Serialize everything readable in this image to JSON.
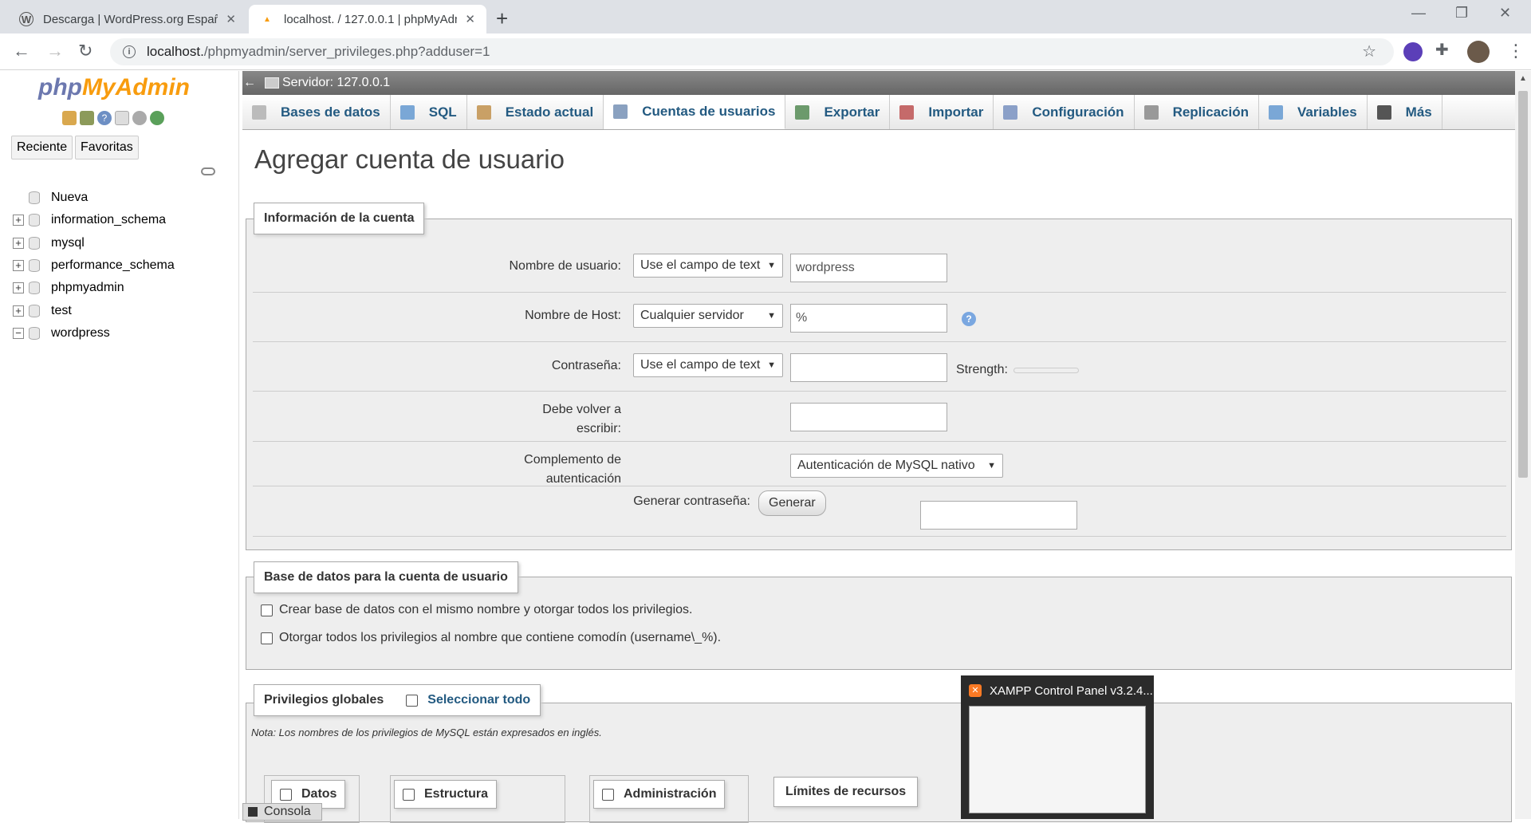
{
  "browser": {
    "tabs": [
      {
        "title": "Descarga | WordPress.org Españ",
        "icon": "wordpress-icon"
      },
      {
        "title": "localhost. / 127.0.0.1 | phpMyAdm",
        "icon": "phpmyadmin-icon"
      }
    ],
    "new_tab": "+",
    "url_host": "localhost.",
    "url_path": "/phpmyadmin/server_privileges.php?adduser=1"
  },
  "left": {
    "logo_php": "php",
    "logo_myadmin": "MyAdmin",
    "btn_recent": "Reciente",
    "btn_favorites": "Favoritas",
    "tree": [
      {
        "label": "Nueva",
        "expander": ""
      },
      {
        "label": "information_schema",
        "expander": "+"
      },
      {
        "label": "mysql",
        "expander": "+"
      },
      {
        "label": "performance_schema",
        "expander": "+"
      },
      {
        "label": "phpmyadmin",
        "expander": "+"
      },
      {
        "label": "test",
        "expander": "+"
      },
      {
        "label": "wordpress",
        "expander": "−"
      }
    ]
  },
  "server": {
    "label": "Servidor: 127.0.0.1"
  },
  "menu": [
    {
      "label": "Bases de datos",
      "icon": "database-icon",
      "color": "#bbb"
    },
    {
      "label": "SQL",
      "icon": "sql-icon",
      "color": "#7aa7d6"
    },
    {
      "label": "Estado actual",
      "icon": "status-icon",
      "color": "#c9a066"
    },
    {
      "label": "Cuentas de usuarios",
      "icon": "users-icon",
      "color": "#8aa1c0"
    },
    {
      "label": "Exportar",
      "icon": "export-icon",
      "color": "#6c9a6c"
    },
    {
      "label": "Importar",
      "icon": "import-icon",
      "color": "#c56a6a"
    },
    {
      "label": "Configuración",
      "icon": "wrench-icon",
      "color": "#8ba0c8"
    },
    {
      "label": "Replicación",
      "icon": "replication-icon",
      "color": "#999"
    },
    {
      "label": "Variables",
      "icon": "variables-icon",
      "color": "#7aa7d6"
    },
    {
      "label": "Más",
      "icon": "triangle-down-icon",
      "color": "#555"
    }
  ],
  "page": {
    "title": "Agregar cuenta de usuario",
    "account": {
      "legend": "Información de la cuenta",
      "username_label": "Nombre de usuario:",
      "username_select": "Use el campo de text",
      "username_value": "wordpress",
      "host_label": "Nombre de Host:",
      "host_select": "Cualquier servidor",
      "host_value": "%",
      "password_label": "Contraseña:",
      "password_select": "Use el campo de text",
      "strength_label": "Strength:",
      "retype_label_1": "Debe volver a",
      "retype_label_2": "escribir:",
      "auth_label_1": "Complemento de",
      "auth_label_2": "autenticación",
      "auth_select": "Autenticación de MySQL nativo",
      "generate_label": "Generar contraseña:",
      "generate_button": "Generar"
    },
    "database": {
      "legend": "Base de datos para la cuenta de usuario",
      "option1": "Crear base de datos con el mismo nombre y otorgar todos los privilegios.",
      "option2": "Otorgar todos los privilegios al nombre que contiene comodín (username\\_%)."
    },
    "global": {
      "legend": "Privilegios globales",
      "select_all": "Seleccionar todo",
      "note": "Nota: Los nombres de los privilegios de MySQL están expresados en inglés.",
      "data": "Datos",
      "structure": "Estructura",
      "admin": "Administración",
      "limits": "Límites de recursos"
    },
    "console": "Consola"
  },
  "xampp": {
    "title": "XAMPP Control Panel v3.2.4..."
  }
}
